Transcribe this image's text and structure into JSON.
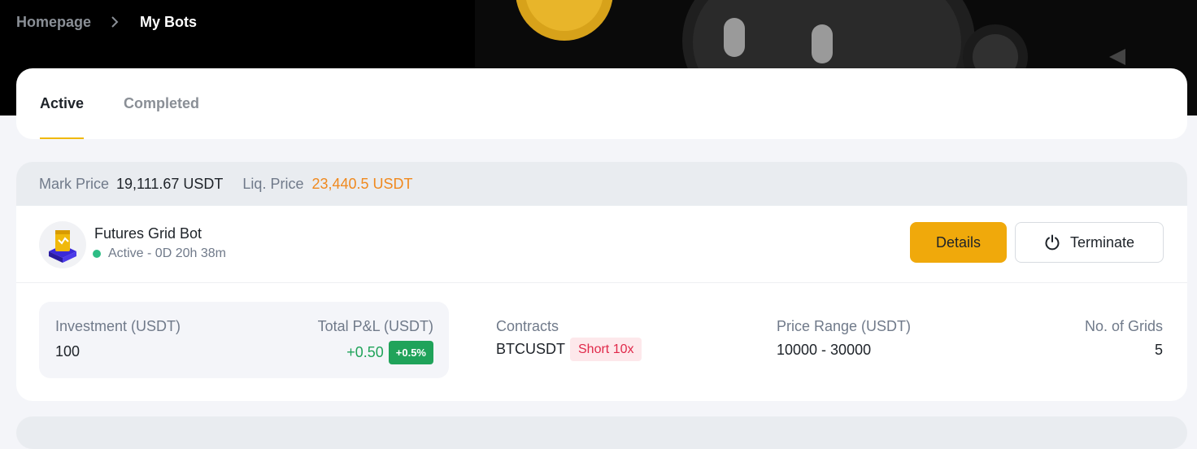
{
  "breadcrumb": {
    "home": "Homepage",
    "current": "My Bots"
  },
  "tabs": [
    {
      "label": "Active"
    },
    {
      "label": "Completed"
    }
  ],
  "price_strip": {
    "mark_label": "Mark Price",
    "mark_value": "19,111.67 USDT",
    "liq_label": "Liq. Price",
    "liq_value": "23,440.5 USDT"
  },
  "bot": {
    "name": "Futures Grid Bot",
    "status": "Active - 0D 20h 38m",
    "details_label": "Details",
    "terminate_label": "Terminate"
  },
  "metrics": {
    "investment_label": "Investment (USDT)",
    "investment_value": "100",
    "pnl_label": "Total P&L (USDT)",
    "pnl_value": "+0.50",
    "pnl_pct": "+0.5%",
    "contracts_label": "Contracts",
    "contracts_value": "BTCUSDT",
    "contracts_badge": "Short 10x",
    "range_label": "Price Range (USDT)",
    "range_value": "10000 - 30000",
    "grids_label": "No. of Grids",
    "grids_value": "5"
  },
  "colors": {
    "accent": "#f0b90b",
    "details_button": "#f0a90b",
    "profit": "#20a35a",
    "loss": "#e0294a",
    "liq_price": "#f0891e"
  },
  "icons": [
    "chevron-right-icon",
    "power-icon",
    "grid-bot-icon",
    "status-dot-icon"
  ]
}
